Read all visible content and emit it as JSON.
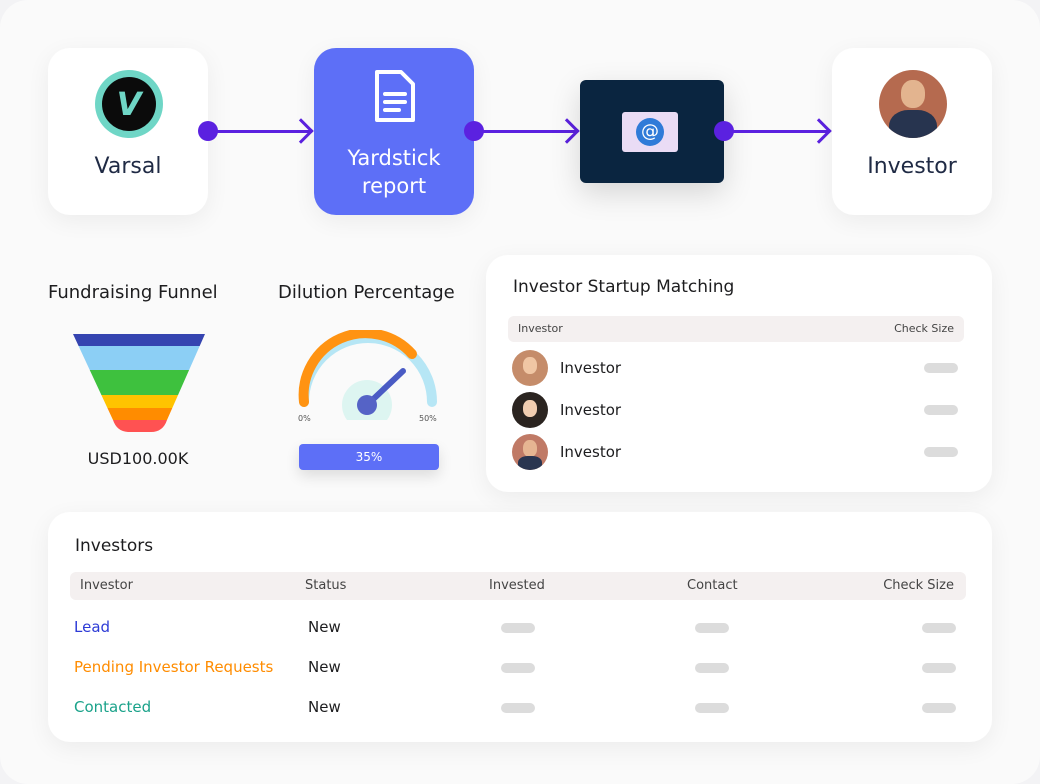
{
  "flow": {
    "source": "Varsal",
    "source_logo_letter": "V",
    "report": "Yardstick report",
    "email_icon": "email-at-icon",
    "target": "Investor"
  },
  "funnel": {
    "title": "Fundraising Funnel",
    "value": "USD100.00K",
    "colors": [
      "#3544b0",
      "#8ccff5",
      "#3ec13e",
      "#ffc300",
      "#ff8c00",
      "#ff5252"
    ]
  },
  "dilution": {
    "title": "Dilution Percentage",
    "min_label": "0%",
    "max_label": "50%",
    "value_label": "35%",
    "value": 35,
    "min": 0,
    "max": 50
  },
  "matching": {
    "title": "Investor Startup Matching",
    "columns": [
      "Investor",
      "Check Size"
    ],
    "rows": [
      {
        "name": "Investor"
      },
      {
        "name": "Investor"
      },
      {
        "name": "Investor"
      }
    ]
  },
  "investors": {
    "title": "Investors",
    "columns": [
      "Investor",
      "Status",
      "Invested",
      "Contact",
      "Check Size"
    ],
    "rows": [
      {
        "name": "Lead",
        "status": "New",
        "color": "#2d3bd6"
      },
      {
        "name": "Pending Investor Requests",
        "status": "New",
        "color": "#ff8c00"
      },
      {
        "name": "Contacted",
        "status": "New",
        "color": "#1aa28a"
      }
    ]
  }
}
